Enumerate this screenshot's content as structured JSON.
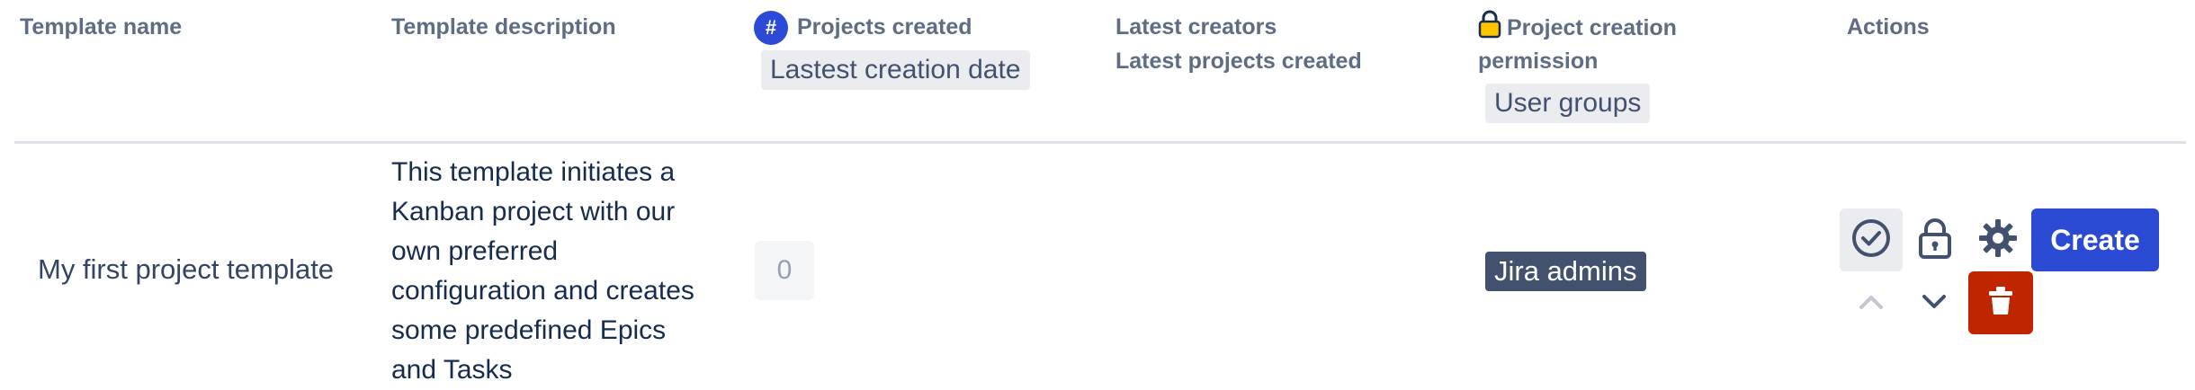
{
  "headers": {
    "template_name": "Template name",
    "template_description": "Template description",
    "projects_created": "Projects created",
    "projects_created_icon": "#",
    "latest_creation_date": "Lastest creation date",
    "latest_creators": "Latest creators",
    "latest_projects_created": "Latest projects created",
    "project_creation_permission_line1": "Project creation",
    "project_creation_permission_line2": "permission",
    "user_groups": "User groups",
    "actions": "Actions"
  },
  "row": {
    "name": "My first project template",
    "description_lines": [
      "This template initiates a",
      "Kanban project with our",
      "own preferred",
      "configuration and creates",
      "some predefined Epics",
      "and Tasks"
    ],
    "projects_created": "0",
    "group": "Jira admins",
    "create_label": "Create"
  },
  "icons": {
    "hash": "hash-icon",
    "lock_header": "lock-icon",
    "check": "check-circle-icon",
    "lock": "lock-icon",
    "gear": "gear-icon",
    "up": "chevron-up-icon",
    "down": "chevron-down-icon",
    "delete": "trash-icon"
  },
  "colors": {
    "primary": "#2b4ad3",
    "danger": "#bf2600",
    "group_badge": "#42526e",
    "lock_yellow": "#ffc400"
  }
}
